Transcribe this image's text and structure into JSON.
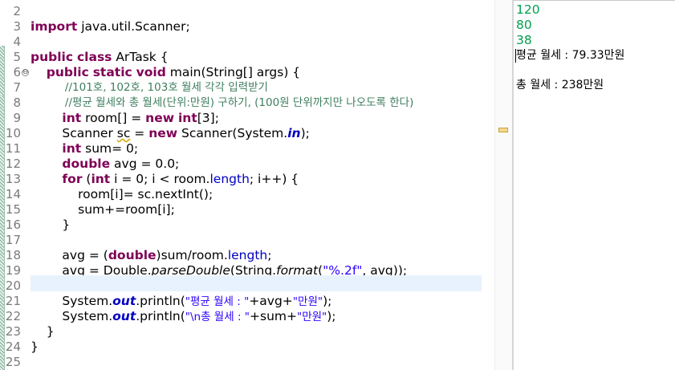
{
  "editor": {
    "line_numbers": [
      "2",
      "3",
      "4",
      "5",
      "6",
      "7",
      "8",
      "9",
      "10",
      "11",
      "12",
      "13",
      "14",
      "15",
      "16",
      "17",
      "18",
      "19",
      "20",
      "21",
      "22",
      "23",
      "24",
      "25"
    ],
    "fold_marker": "⊖",
    "tokens": {
      "kw_import": "import",
      "import_path": " java.util.Scanner;",
      "kw_public": "public",
      "kw_class": "class",
      "class_decl_rest": " ArTask {",
      "kw_static": "static",
      "kw_void": "void",
      "main_sig_rest": " main(String[] args) {",
      "comment_1": "//101호, 102호, 103호 월세 각각 입력받기",
      "comment_2": "//평균 월세와 총 월세(단위:만원) 구하기, (100원 단위까지만 나오도록 한다)",
      "kw_int": "int",
      "room_decl_mid": " room[] = ",
      "kw_new": "new",
      "room_decl_end": "[3];",
      "scanner_type": "Scanner ",
      "var_sc": "sc",
      "assign_op": " = ",
      "scanner_ctor": " Scanner(System.",
      "field_in": "in",
      "ctor_close": ");",
      "sum_decl_rest": " sum= 0;",
      "kw_double": "double",
      "avg_decl_rest": " avg = 0.0;",
      "kw_for": "for",
      "for_open": " (",
      "for_mid": " i = 0; i < room.",
      "field_length": "length",
      "for_end": "; i++) {",
      "loop_line_1": "room[i]= sc.nextInt();",
      "loop_line_2": "sum+=room[i];",
      "close_brace": "}",
      "avg_assign_prefix": "avg = (",
      "avg_assign_mid": ")sum/room.",
      "semicolon": ";",
      "parse_prefix": "avg = Double.",
      "parse_method": "parseDouble",
      "string_open": "(String.",
      "format_method": "format",
      "paren_open": "(",
      "format_str": "\"%.2f\"",
      "format_tail": ", avg));",
      "sys_prefix": "System.",
      "field_out": "out",
      "println_open": ".println(",
      "str_avg": "\"평균 월세 : \"",
      "avg_concat": "+avg+",
      "str_unit": "\"만원\"",
      "stmt_end": ");",
      "str_total": "\"\\n총 월세 : \"",
      "sum_concat": "+sum+",
      "method_close": "}",
      "class_close": "}"
    }
  },
  "console": {
    "inputs": [
      "120",
      "80",
      "38"
    ],
    "average_line": "평균 월세 : 79.33만원",
    "total_line": "총 월세 : 238만원"
  },
  "colors": {
    "keyword": "#7f0055",
    "string": "#2a00ff",
    "comment": "#3f7f5f",
    "field": "#0000c0",
    "console_input": "#00a050",
    "current_line": "#e8f2fe"
  }
}
